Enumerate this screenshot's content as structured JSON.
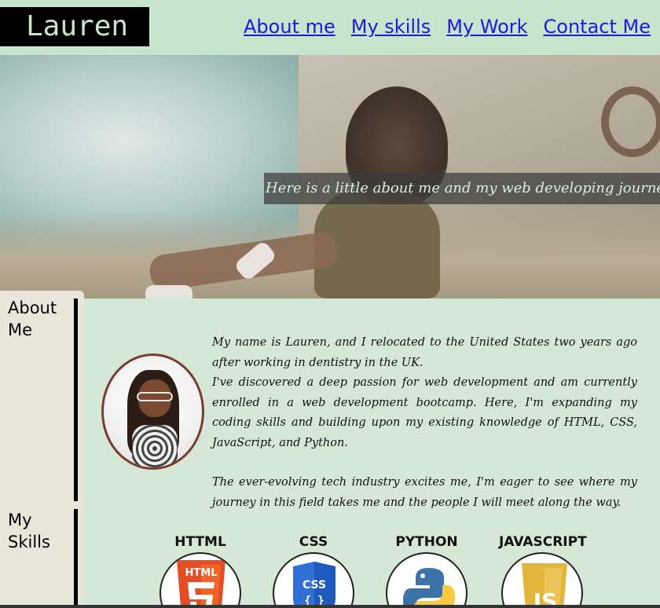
{
  "header": {
    "logo": "Lauren",
    "nav": [
      "About me",
      "My skills",
      "My Work",
      "Contact Me"
    ]
  },
  "hero": {
    "tagline": "Here is a little about me and my web developing journey so far..."
  },
  "sections": {
    "about_label": "About Me",
    "skills_label": "My Skills"
  },
  "about": {
    "p1": "My name is Lauren, and I relocated to the United States two years ago after working in dentistry in the UK.",
    "p2": "I've discovered a deep passion for web development and am currently enrolled in a web development bootcamp. Here, I'm expanding my coding skills and building upon my existing knowledge of HTML, CSS, JavaScript, and Python.",
    "p3": "The ever-evolving tech industry excites me, I'm eager to see where my journey in this field takes me and the people I will meet along the way."
  },
  "skills": {
    "items": [
      {
        "label": "HTTML",
        "icon": "html5-icon",
        "color": "#e44d26",
        "badge": "HTML"
      },
      {
        "label": "CSS",
        "icon": "css3-icon",
        "color": "#2f6fd6",
        "badge": "CSS"
      },
      {
        "label": "PYTHON",
        "icon": "python-icon",
        "color": "#3b73a8",
        "badge": ""
      },
      {
        "label": "JAVASCRIPT",
        "icon": "javascript-icon",
        "color": "#e2b53b",
        "badge": "JS"
      }
    ]
  },
  "colors": {
    "header_bg": "#c9e4cc",
    "page_bg": "#d5e8d6",
    "sidebar_bg": "#e8e6d9",
    "link": "#1a1ae6",
    "logo_bg": "#000000"
  }
}
